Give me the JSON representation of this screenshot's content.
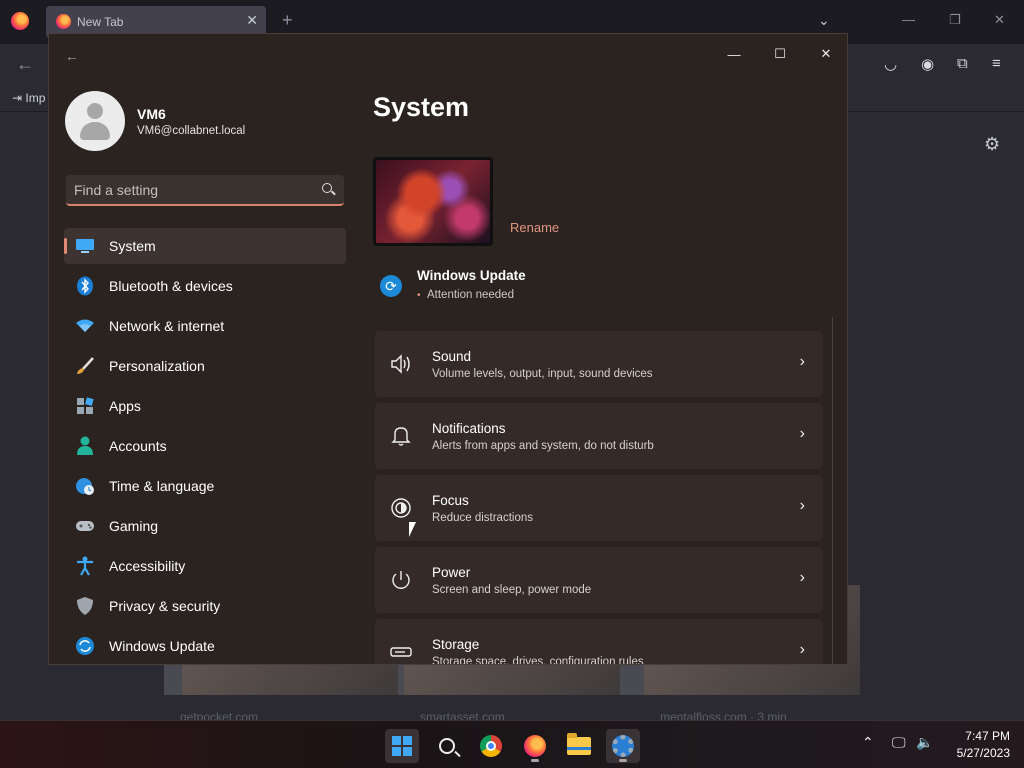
{
  "browser": {
    "tab_title": "New Tab",
    "tab_close": "✕",
    "new_tab": "+",
    "list_tabs": "⌄",
    "bookmark_import": "Imp",
    "card_labels": [
      "getpocket.com",
      "smartasset.com",
      "mentalfloss.com · 3 min"
    ]
  },
  "settings": {
    "user": {
      "name": "VM6",
      "email": "VM6@collabnet.local"
    },
    "search": {
      "placeholder": "Find a setting"
    },
    "nav": [
      {
        "label": "System",
        "icon": "monitor-icon",
        "selected": true
      },
      {
        "label": "Bluetooth & devices",
        "icon": "bluetooth-icon"
      },
      {
        "label": "Network & internet",
        "icon": "wifi-icon"
      },
      {
        "label": "Personalization",
        "icon": "brush-icon"
      },
      {
        "label": "Apps",
        "icon": "apps-icon"
      },
      {
        "label": "Accounts",
        "icon": "person-icon"
      },
      {
        "label": "Time & language",
        "icon": "globe-clock-icon"
      },
      {
        "label": "Gaming",
        "icon": "gamepad-icon"
      },
      {
        "label": "Accessibility",
        "icon": "accessibility-icon"
      },
      {
        "label": "Privacy & security",
        "icon": "shield-icon"
      },
      {
        "label": "Windows Update",
        "icon": "update-icon"
      }
    ],
    "page_title": "System",
    "rename": "Rename",
    "windows_update": {
      "title": "Windows Update",
      "status": "Attention needed"
    },
    "cards": [
      {
        "title": "Sound",
        "subtitle": "Volume levels, output, input, sound devices",
        "icon": "speaker-icon"
      },
      {
        "title": "Notifications",
        "subtitle": "Alerts from apps and system, do not disturb",
        "icon": "bell-icon"
      },
      {
        "title": "Focus",
        "subtitle": "Reduce distractions",
        "icon": "focus-icon"
      },
      {
        "title": "Power",
        "subtitle": "Screen and sleep, power mode",
        "icon": "power-icon"
      },
      {
        "title": "Storage",
        "subtitle": "Storage space, drives, configuration rules",
        "icon": "storage-icon"
      }
    ]
  },
  "taskbar": {
    "time": "7:47 PM",
    "date": "5/27/2023"
  },
  "colors": {
    "accent": "#e08a74",
    "window_bg": "#2a2320",
    "card_bg": "#342b28"
  }
}
